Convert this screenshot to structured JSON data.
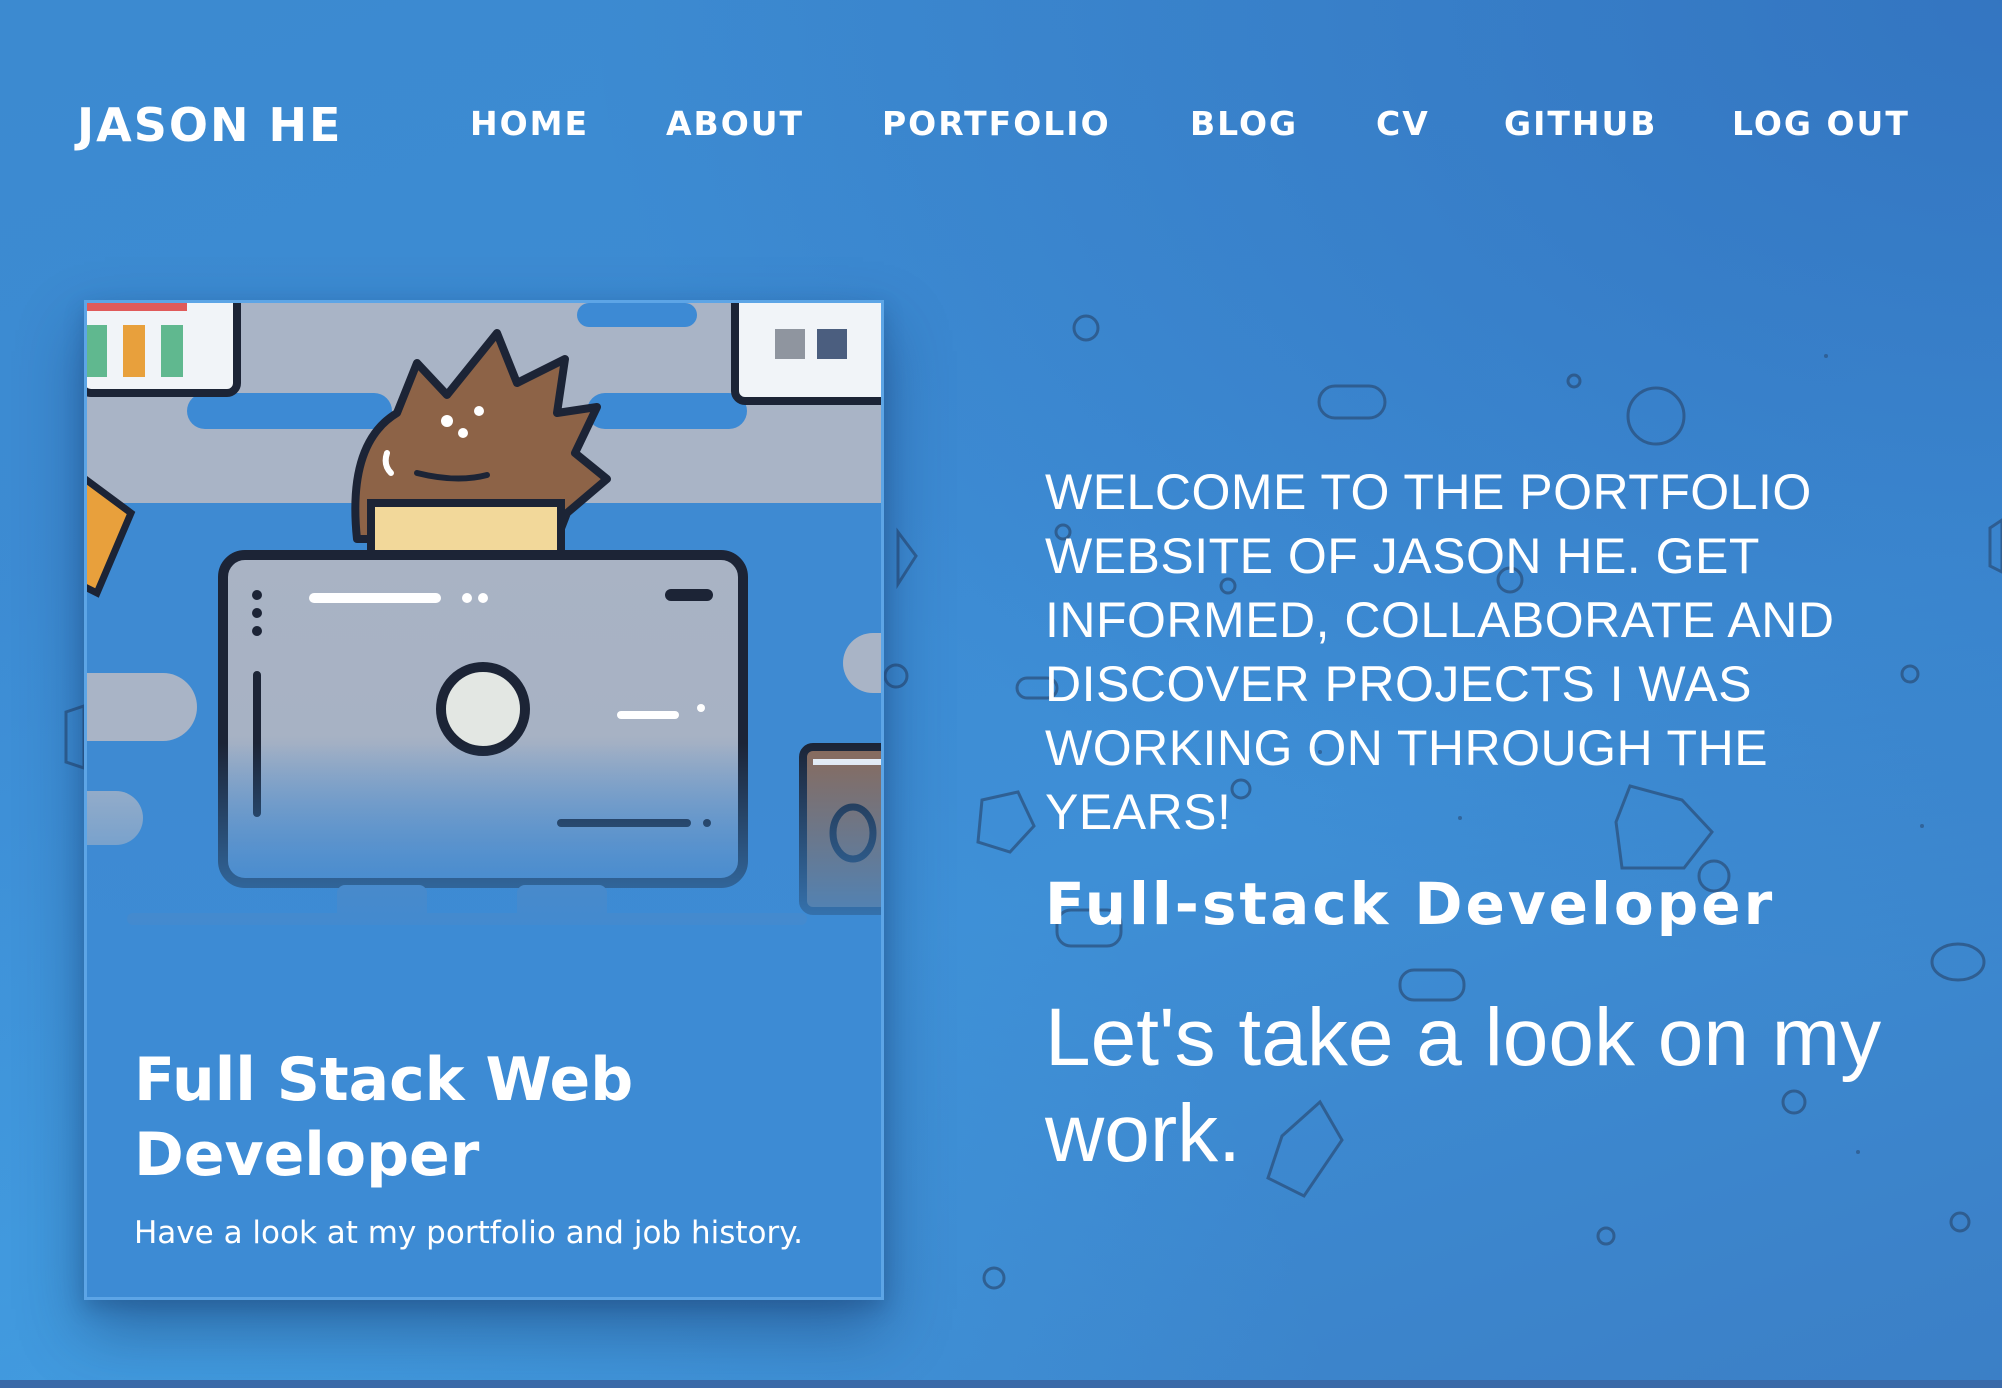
{
  "brand": "JASON HE",
  "nav": {
    "items": [
      {
        "label": "HOME"
      },
      {
        "label": "ABOUT"
      },
      {
        "label": "PORTFOLIO"
      },
      {
        "label": "BLOG"
      },
      {
        "label": "CV"
      },
      {
        "label": "GITHUB"
      },
      {
        "label": "LOG OUT"
      }
    ]
  },
  "card": {
    "title": "Full Stack Web Developer",
    "text": "Have a look at my portfolio and job history.",
    "image_icon": "developer-at-computer-illustration"
  },
  "hero": {
    "welcome": "WELCOME TO THE PORTFOLIO WEBSITE OF JASON HE. GET INFORMED, COLLABORATE AND DISCOVER PROJECTS I WAS WORKING ON THROUGH THE YEARS!",
    "role": "Full-stack Developer",
    "cta": "Let's take a look on my work."
  },
  "colors": {
    "background": "#3d8cd4",
    "text": "#ffffff",
    "card_border": "#5da5e6",
    "shape_stroke": "#1e3a5f"
  }
}
